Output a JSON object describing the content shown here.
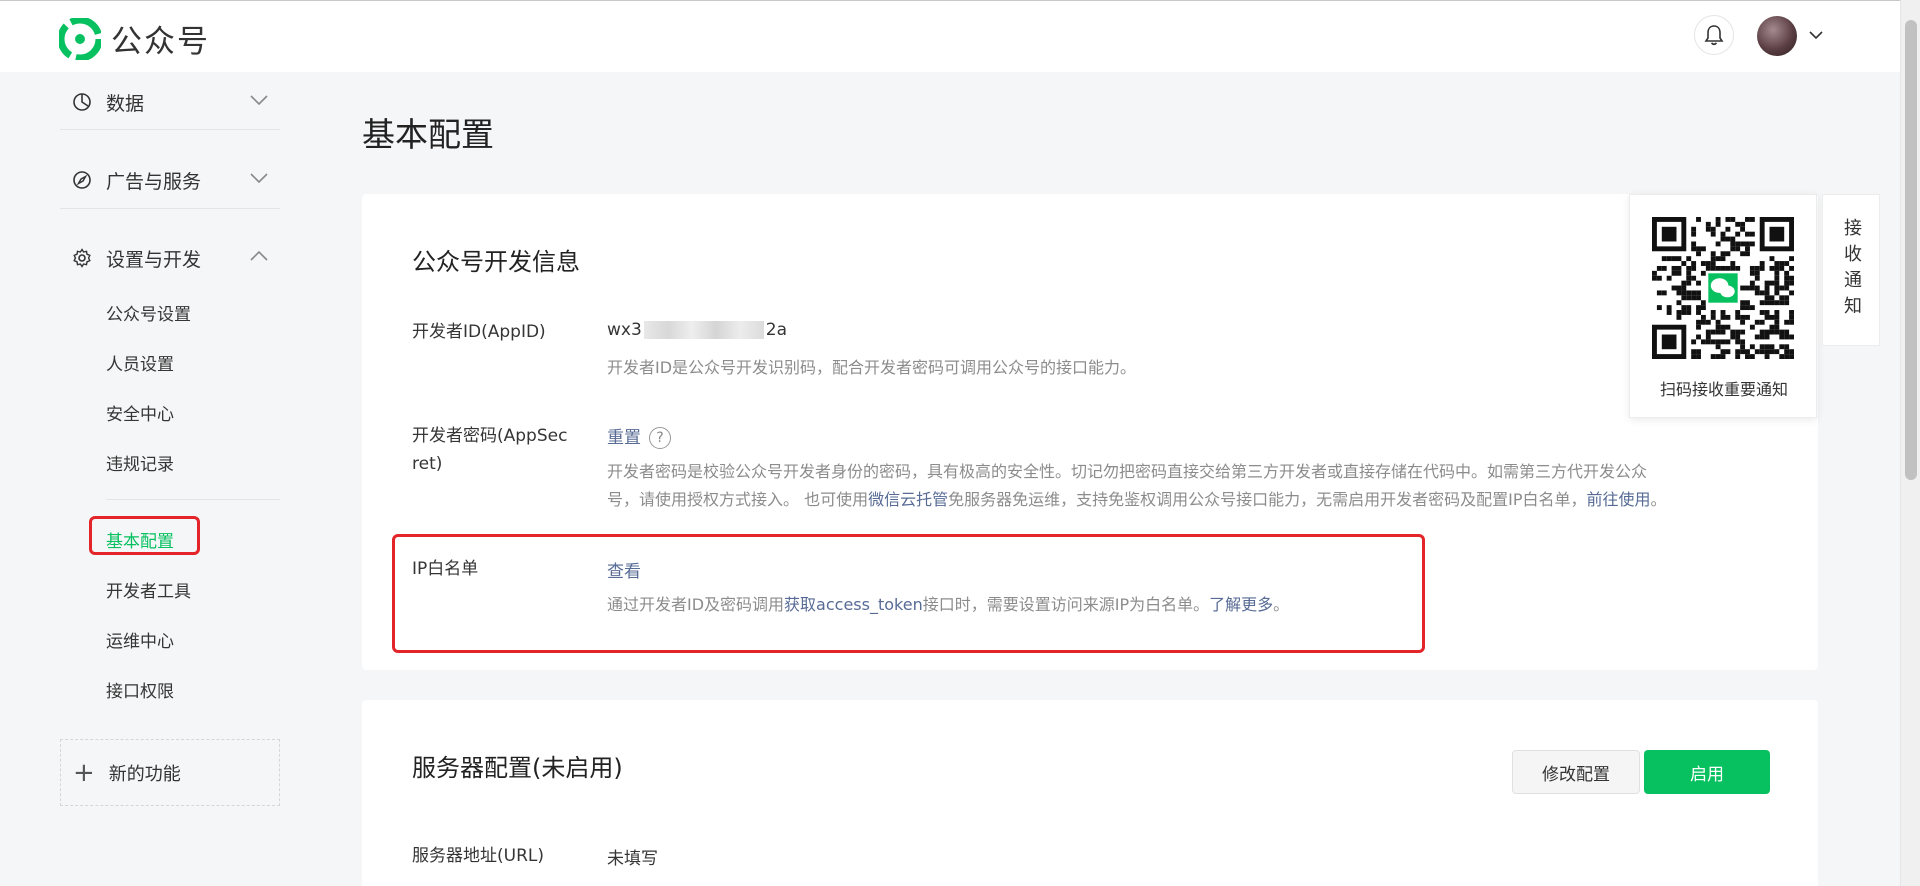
{
  "header": {
    "brand": "公众号",
    "brand_color": "#07c160"
  },
  "sidebar": {
    "groups": [
      {
        "label": "数据",
        "icon": "chart-pie-icon",
        "expanded": false
      },
      {
        "label": "广告与服务",
        "icon": "compass-icon",
        "expanded": false
      },
      {
        "label": "设置与开发",
        "icon": "gear-icon",
        "expanded": true
      }
    ],
    "subitems": [
      "公众号设置",
      "人员设置",
      "安全中心",
      "违规记录",
      "基本配置",
      "开发者工具",
      "运维中心",
      "接口权限"
    ],
    "active": "基本配置",
    "new_feature": "新的功能"
  },
  "page": {
    "title": "基本配置"
  },
  "dev_info": {
    "title": "公众号开发信息",
    "appid_label": "开发者ID(AppID)",
    "appid_prefix": "wx3",
    "appid_suffix": "2a",
    "appid_desc": "开发者ID是公众号开发识别码，配合开发者密码可调用公众号的接口能力。",
    "secret_label_1": "开发者密码(AppSec",
    "secret_label_2": "ret)",
    "secret_action": "重置",
    "secret_desc_1": "开发者密码是校验公众号开发者身份的密码，具有极高的安全性。切记勿把密码直接交给第三方开发者或直接存储在代码中。如需第三方代开发公众",
    "secret_desc_2a": "号，请使用授权方式接入。 也可使用",
    "secret_desc_link1": "微信云托管",
    "secret_desc_2b": "免服务器免运维，支持免鉴权调用公众号接口能力，无需启用开发者密码及配置IP白名单，",
    "secret_desc_link2": "前往使用",
    "secret_desc_end": "。",
    "ip_label": "IP白名单",
    "ip_action": "查看",
    "ip_desc_a": "通过开发者ID及密码调用",
    "ip_desc_link1": "获取access_token",
    "ip_desc_b": "接口时，需要设置访问来源IP为白名单。",
    "ip_desc_link2": "了解更多",
    "ip_desc_end": "。"
  },
  "server_config": {
    "title": "服务器配置(未启用)",
    "modify_button": "修改配置",
    "enable_button": "启用",
    "url_label": "服务器地址(URL)",
    "url_value": "未填写"
  },
  "qr": {
    "label": "扫码接收重要通知"
  },
  "notify_tab": {
    "label": "接收通知"
  },
  "colors": {
    "link": "#576b95",
    "accent": "#07c160",
    "highlight": "#e3252a"
  }
}
